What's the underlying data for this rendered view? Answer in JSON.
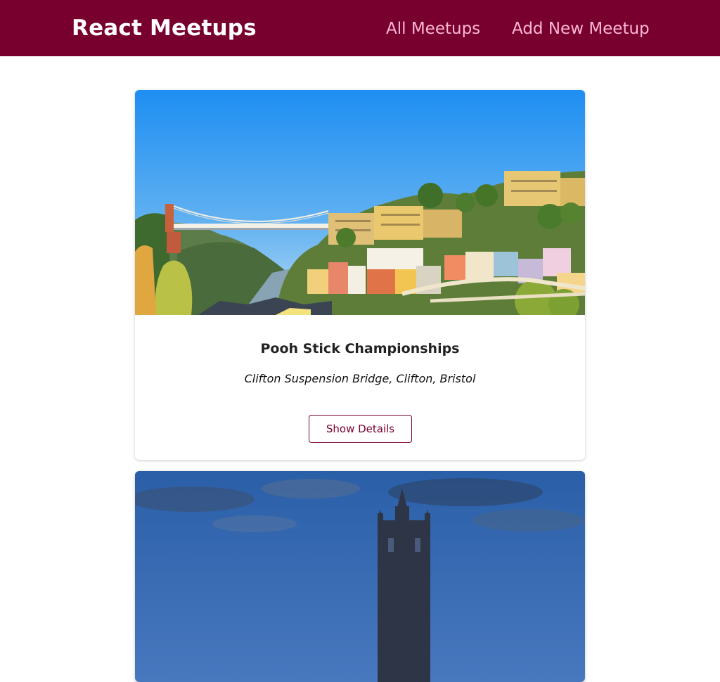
{
  "header": {
    "logo": "React Meetups",
    "nav": {
      "all_meetups": "All Meetups",
      "add_new_meetup": "Add New Meetup"
    }
  },
  "meetups": [
    {
      "title": "Pooh Stick Championships",
      "address": "Clifton Suspension Bridge, Clifton, Bristol",
      "button_label": "Show Details",
      "image_alt": "clifton-bridge-photo"
    },
    {
      "image_alt": "cathedral-sky-photo"
    }
  ],
  "colors": {
    "brand": "#77002e",
    "nav_link": "#fcb8d2",
    "background": "#ffffff"
  }
}
